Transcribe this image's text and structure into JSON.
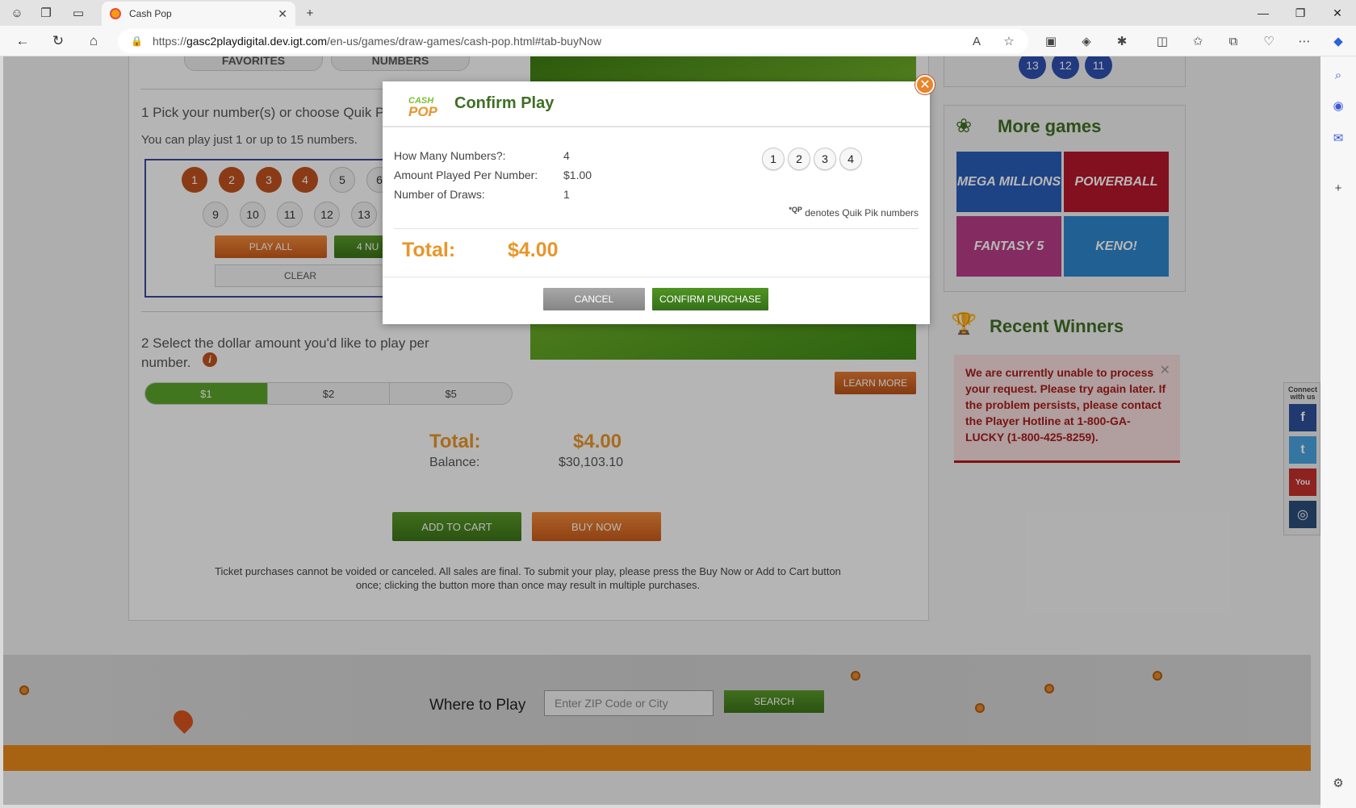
{
  "browser": {
    "tab_title": "Cash Pop",
    "url_prefix": "https://",
    "url_host": "gasc2playdigital.dev.igt.com",
    "url_path": "/en-us/games/draw-games/cash-pop.html#tab-buyNow"
  },
  "page": {
    "tabs": [
      "FAVORITES",
      "NUMBERS"
    ],
    "step1": {
      "title": "1  Pick your number(s) or choose Quik P",
      "subtitle": "You can play just 1 or up to 15 numbers.",
      "row1": [
        "1",
        "2",
        "3",
        "4",
        "5",
        "6"
      ],
      "row2": [
        "9",
        "10",
        "11",
        "12",
        "13"
      ],
      "play_all": "PLAY ALL",
      "quick_numbers": "4 NU",
      "clear": "CLEAR"
    },
    "step2": {
      "title_line1": "2  Select the dollar amount you'd like to play per",
      "title_line2": "number.",
      "info_icon": "i",
      "amounts": [
        "$1",
        "$2",
        "$5"
      ]
    },
    "learn_more": "LEARN MORE",
    "total_label": "Total:",
    "total_value": "$4.00",
    "balance_label": "Balance:",
    "balance_value": "$30,103.10",
    "add_to_cart": "ADD TO CART",
    "buy_now": "BUY NOW",
    "disclaimer": "Ticket purchases cannot be voided or canceled. All sales are final. To submit your play, please press the Buy Now or Add to Cart button once; clicking the button more than once may result in multiple purchases."
  },
  "sidebar": {
    "recent_balls": [
      "13",
      "12",
      "11"
    ],
    "more_games_title": "More games",
    "games": [
      "MEGA MILLIONS",
      "POWERBALL",
      "FANTASY 5",
      "KENO!"
    ],
    "recent_winners_title": "Recent Winners",
    "error_message": "We are currently unable to process your request. Please try again later. If the problem persists, please contact the Player Hotline at 1-800-GA-LUCKY (1-800-425-8259).",
    "connect_label": "Connect with us",
    "social": [
      "f",
      "t",
      "You",
      "◎"
    ]
  },
  "footer": {
    "where_to_play": "Where to Play",
    "zip_placeholder": "Enter ZIP Code or City",
    "search": "SEARCH"
  },
  "modal": {
    "logo_cash": "CASH",
    "logo_pop": "POP",
    "title": "Confirm Play",
    "how_many_label": "How Many Numbers?:",
    "how_many_value": "4",
    "amount_label": "Amount Played Per Number:",
    "amount_value": "$1.00",
    "draws_label": "Number of Draws:",
    "draws_value": "1",
    "numbers": [
      "1",
      "2",
      "3",
      "4"
    ],
    "qp_sup": "*QP",
    "qp_text": " denotes Quik Pik numbers",
    "total_label": "Total:",
    "total_value": "$4.00",
    "cancel": "CANCEL",
    "confirm": "CONFIRM PURCHASE"
  }
}
